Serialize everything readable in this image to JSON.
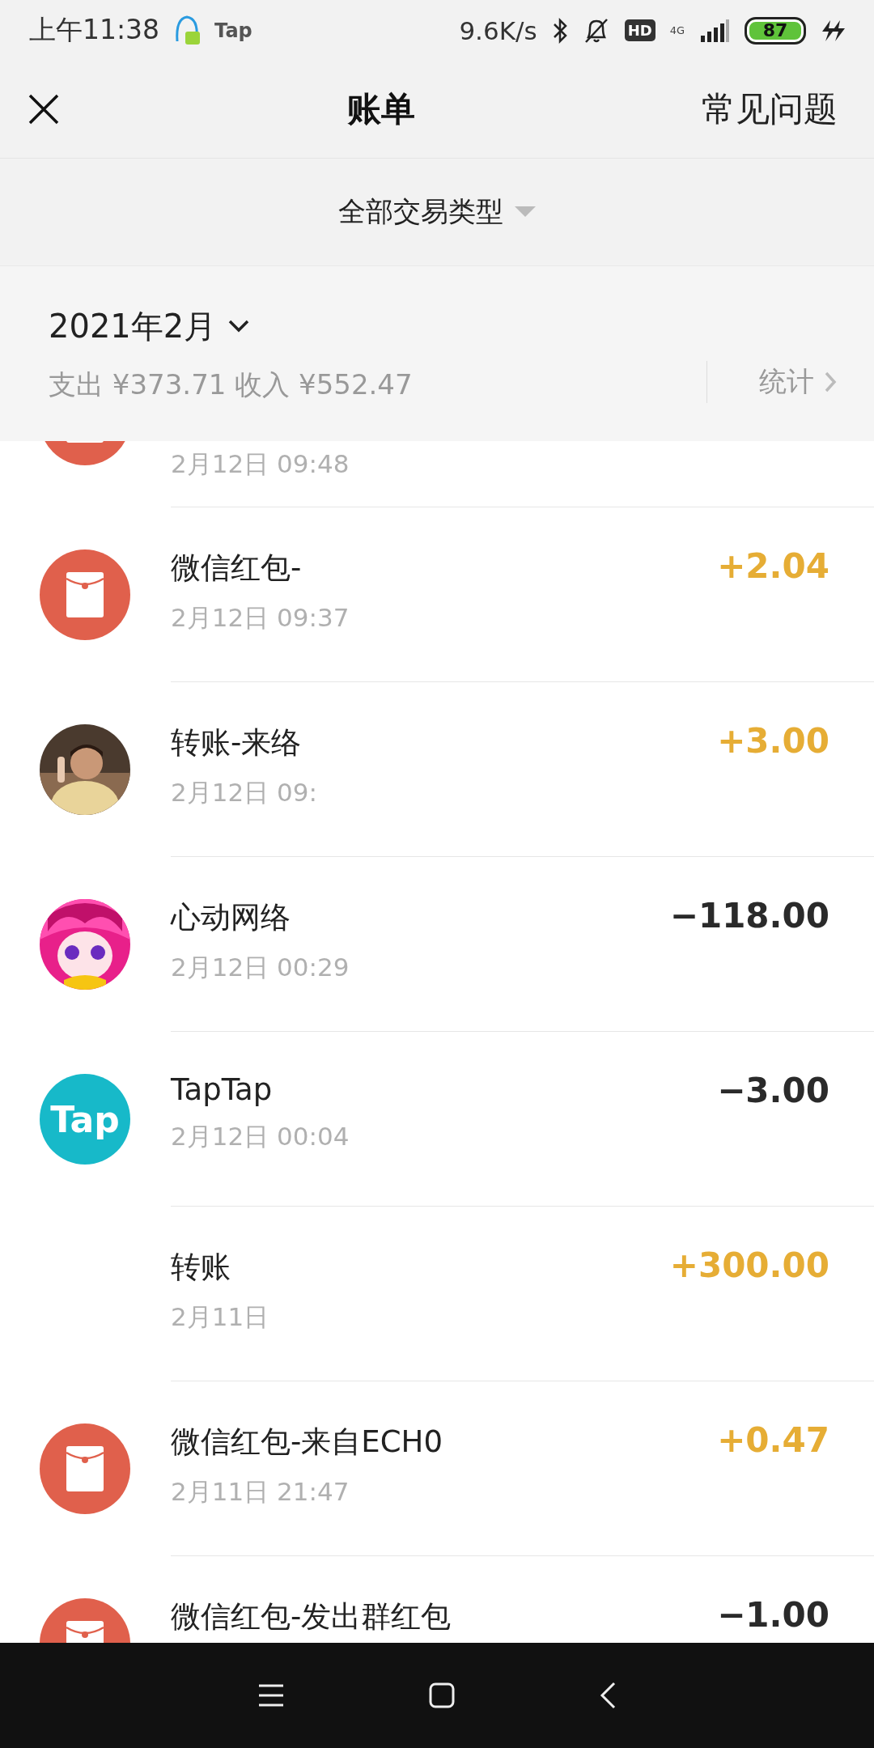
{
  "status_bar": {
    "time": "上午11:38",
    "notification_text": "Tap",
    "speed": "9.6K/s",
    "hd": "HD",
    "network": "4G",
    "battery": "87"
  },
  "nav": {
    "title": "账单",
    "right_link": "常见问题"
  },
  "filter": {
    "label": "全部交易类型"
  },
  "month": {
    "title": "2021年2月",
    "summary": "支出 ¥373.71 收入 ¥552.47",
    "stats_link": "统计"
  },
  "rows": [
    {
      "avatar": {
        "kind": "envelope"
      },
      "date": "2月12日 09:48"
    },
    {
      "avatar": {
        "kind": "envelope"
      },
      "title": "微信红包-",
      "date": "2月12日 09:37",
      "amount": "+2.04",
      "kind": "income"
    },
    {
      "title": "转账-来络",
      "date": "2月12日 09:",
      "amount": "+3.00",
      "kind": "income"
    },
    {
      "avatar": {
        "kind": "character"
      },
      "title": "心动网络",
      "date": "2月12日 00:29",
      "amount": "−118.00",
      "kind": "expense"
    },
    {
      "avatar": {
        "kind": "logo",
        "text": "Tap"
      },
      "title": "TapTap",
      "date": "2月12日 00:04",
      "amount": "−3.00",
      "kind": "expense"
    },
    {
      "title": "转账",
      "date": "2月11日",
      "amount": "+300.00",
      "kind": "income"
    },
    {
      "avatar": {
        "kind": "envelope"
      },
      "title": "微信红包-来自ECH0",
      "date": "2月11日 21:47",
      "amount": "+0.47",
      "kind": "income"
    },
    {
      "avatar": {
        "kind": "envelope"
      },
      "title": "微信红包-发出群红包",
      "amount": "−1.00",
      "kind": "expense"
    }
  ]
}
